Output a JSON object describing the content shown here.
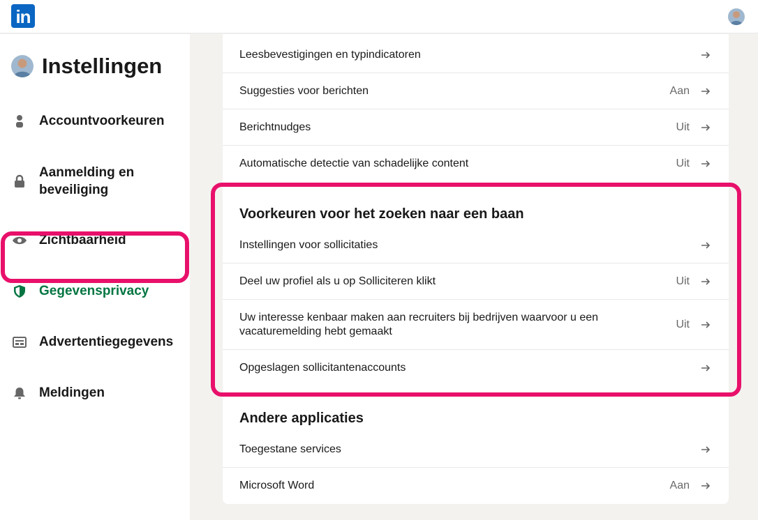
{
  "header": {
    "logo_text": "in"
  },
  "sidebar": {
    "title": "Instellingen",
    "items": [
      {
        "label": "Accountvoorkeuren",
        "icon": "person-icon"
      },
      {
        "label": "Aanmelding en beveiliging",
        "icon": "lock-icon"
      },
      {
        "label": "Zichtbaarheid",
        "icon": "eye-icon"
      },
      {
        "label": "Gegevensprivacy",
        "icon": "shield-icon",
        "active": true
      },
      {
        "label": "Advertentiegegevens",
        "icon": "ad-icon"
      },
      {
        "label": "Meldingen",
        "icon": "bell-icon"
      }
    ]
  },
  "main": {
    "top_rows": [
      {
        "label": "Leesbevestigingen en typindicatoren",
        "value": ""
      },
      {
        "label": "Suggesties voor berichten",
        "value": "Aan"
      },
      {
        "label": "Berichtnudges",
        "value": "Uit"
      },
      {
        "label": "Automatische detectie van schadelijke content",
        "value": "Uit"
      }
    ],
    "job_section": {
      "title": "Voorkeuren voor het zoeken naar een baan",
      "rows": [
        {
          "label": "Instellingen voor sollicitaties",
          "value": ""
        },
        {
          "label": "Deel uw profiel als u op Solliciteren klikt",
          "value": "Uit"
        },
        {
          "label": "Uw interesse kenbaar maken aan recruiters bij bedrijven waarvoor u een vacaturemelding hebt gemaakt",
          "value": "Uit"
        },
        {
          "label": "Opgeslagen sollicitantenaccounts",
          "value": ""
        }
      ]
    },
    "apps_section": {
      "title": "Andere applicaties",
      "rows": [
        {
          "label": "Toegestane services",
          "value": ""
        },
        {
          "label": "Microsoft Word",
          "value": "Aan"
        }
      ]
    }
  },
  "colors": {
    "brand": "#0a66c2",
    "active": "#057642",
    "highlight": "#e8106a"
  }
}
